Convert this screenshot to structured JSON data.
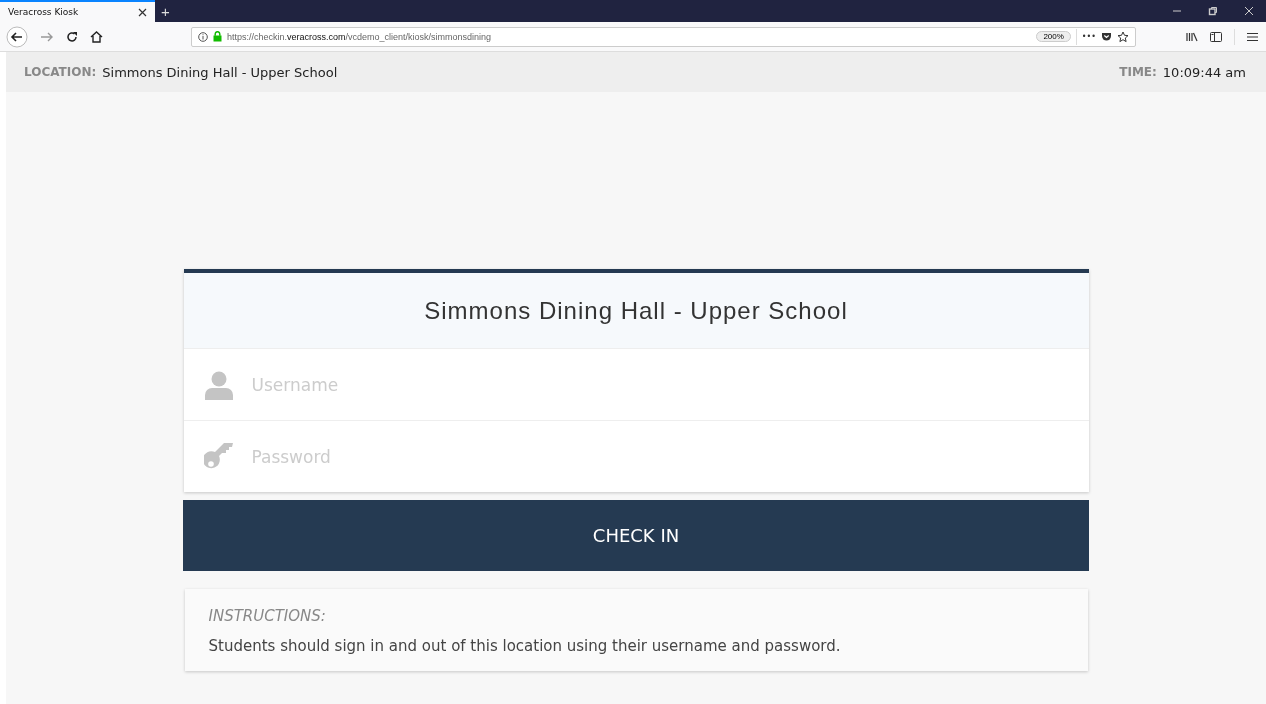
{
  "browser": {
    "tab": {
      "title": "Veracross Kiosk",
      "selected": true
    },
    "new_tab": "+",
    "url": "https://checkin.**veracross.com**/vcdemo_client/kiosk/simmonsdining",
    "zoom": "200%",
    "more": "•••"
  },
  "header": {
    "location_label": "LOCATION:",
    "location": "Simmons Dining Hall - Upper School",
    "time_label": "TIME:",
    "time": "10:09:44 am"
  },
  "card": {
    "title": "Simmons Dining Hall - Upper School",
    "fields": [
      {
        "kind": "user",
        "placeholder": "Username"
      },
      {
        "kind": "key",
        "placeholder": "Password"
      }
    ]
  },
  "button": "CHECK IN",
  "instructions": {
    "heading": "INSTRUCTIONS:",
    "text": "Students should sign in and out of this location using their username and password."
  }
}
